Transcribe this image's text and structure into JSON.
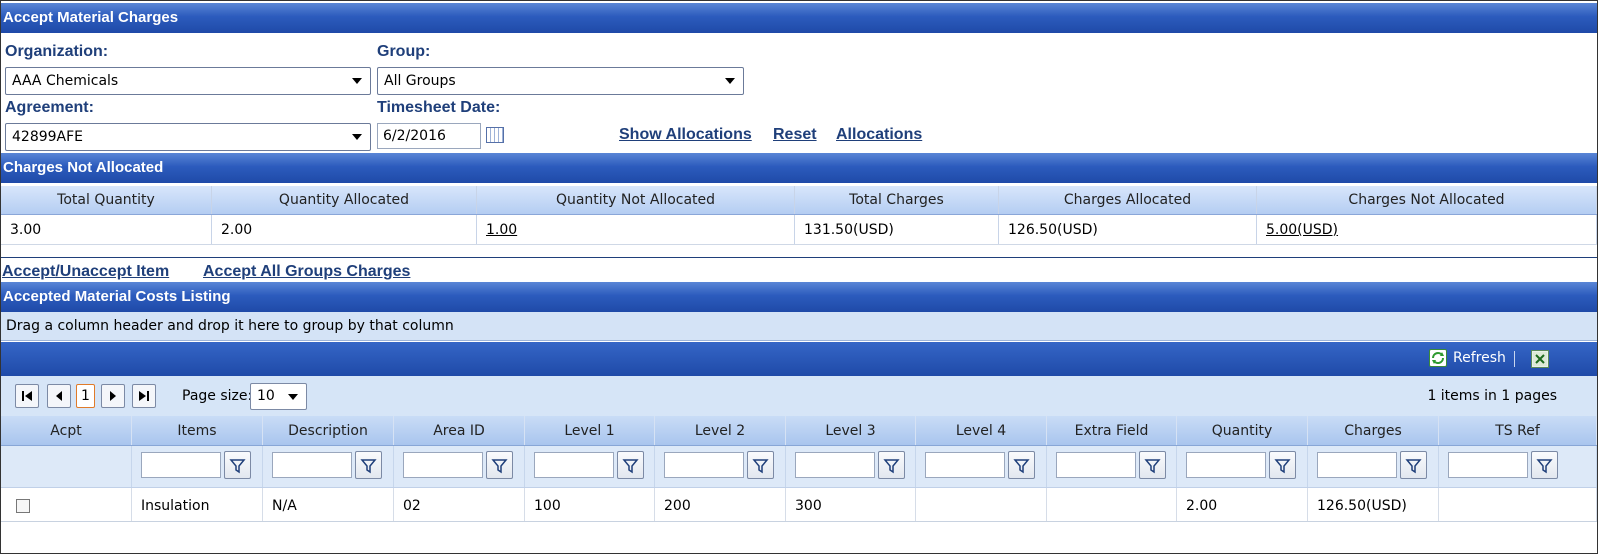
{
  "header": {
    "title": "Accept Material Charges"
  },
  "form": {
    "organization_label": "Organization:",
    "organization_value": "AAA Chemicals",
    "group_label": "Group:",
    "group_value": "All Groups",
    "agreement_label": "Agreement:",
    "agreement_value": "42899AFE",
    "timesheet_label": "Timesheet Date:",
    "timesheet_value": "6/2/2016"
  },
  "links": {
    "show_allocations": "Show Allocations",
    "reset": "Reset",
    "allocations": "Allocations",
    "accept_unaccept": "Accept/Unaccept Item",
    "accept_all_groups": "Accept All Groups Charges"
  },
  "charges_section": {
    "title": "Charges Not Allocated",
    "headers": [
      "Total Quantity",
      "Quantity Allocated",
      "Quantity Not Allocated",
      "Total Charges",
      "Charges Allocated",
      "Charges Not Allocated"
    ],
    "values": [
      "3.00",
      "2.00",
      "1.00",
      "131.50(USD)",
      "126.50(USD)",
      "5.00(USD)"
    ]
  },
  "listing": {
    "title": "Accepted Material Costs Listing",
    "group_hint": "Drag a column header and drop it here to group by that column",
    "refresh_label": "Refresh",
    "current_page": "1",
    "page_size_label": "Page size:",
    "page_size_value": "10",
    "items_info": "1 items in 1 pages",
    "columns": [
      "Acpt",
      "Items",
      "Description",
      "Area ID",
      "Level 1",
      "Level 2",
      "Level 3",
      "Level 4",
      "Extra Field",
      "Quantity",
      "Charges",
      "TS Ref"
    ],
    "rows": [
      {
        "items": "Insulation",
        "description": "N/A",
        "area_id": "02",
        "level1": "100",
        "level2": "200",
        "level3": "300",
        "level4": "",
        "extra": "",
        "quantity": "2.00",
        "charges": "126.50(USD)",
        "ts_ref": ""
      }
    ]
  },
  "colors": {
    "band": "#2c5bbd",
    "label": "#1f3f7a",
    "grid_header": "#b4cdf2"
  }
}
